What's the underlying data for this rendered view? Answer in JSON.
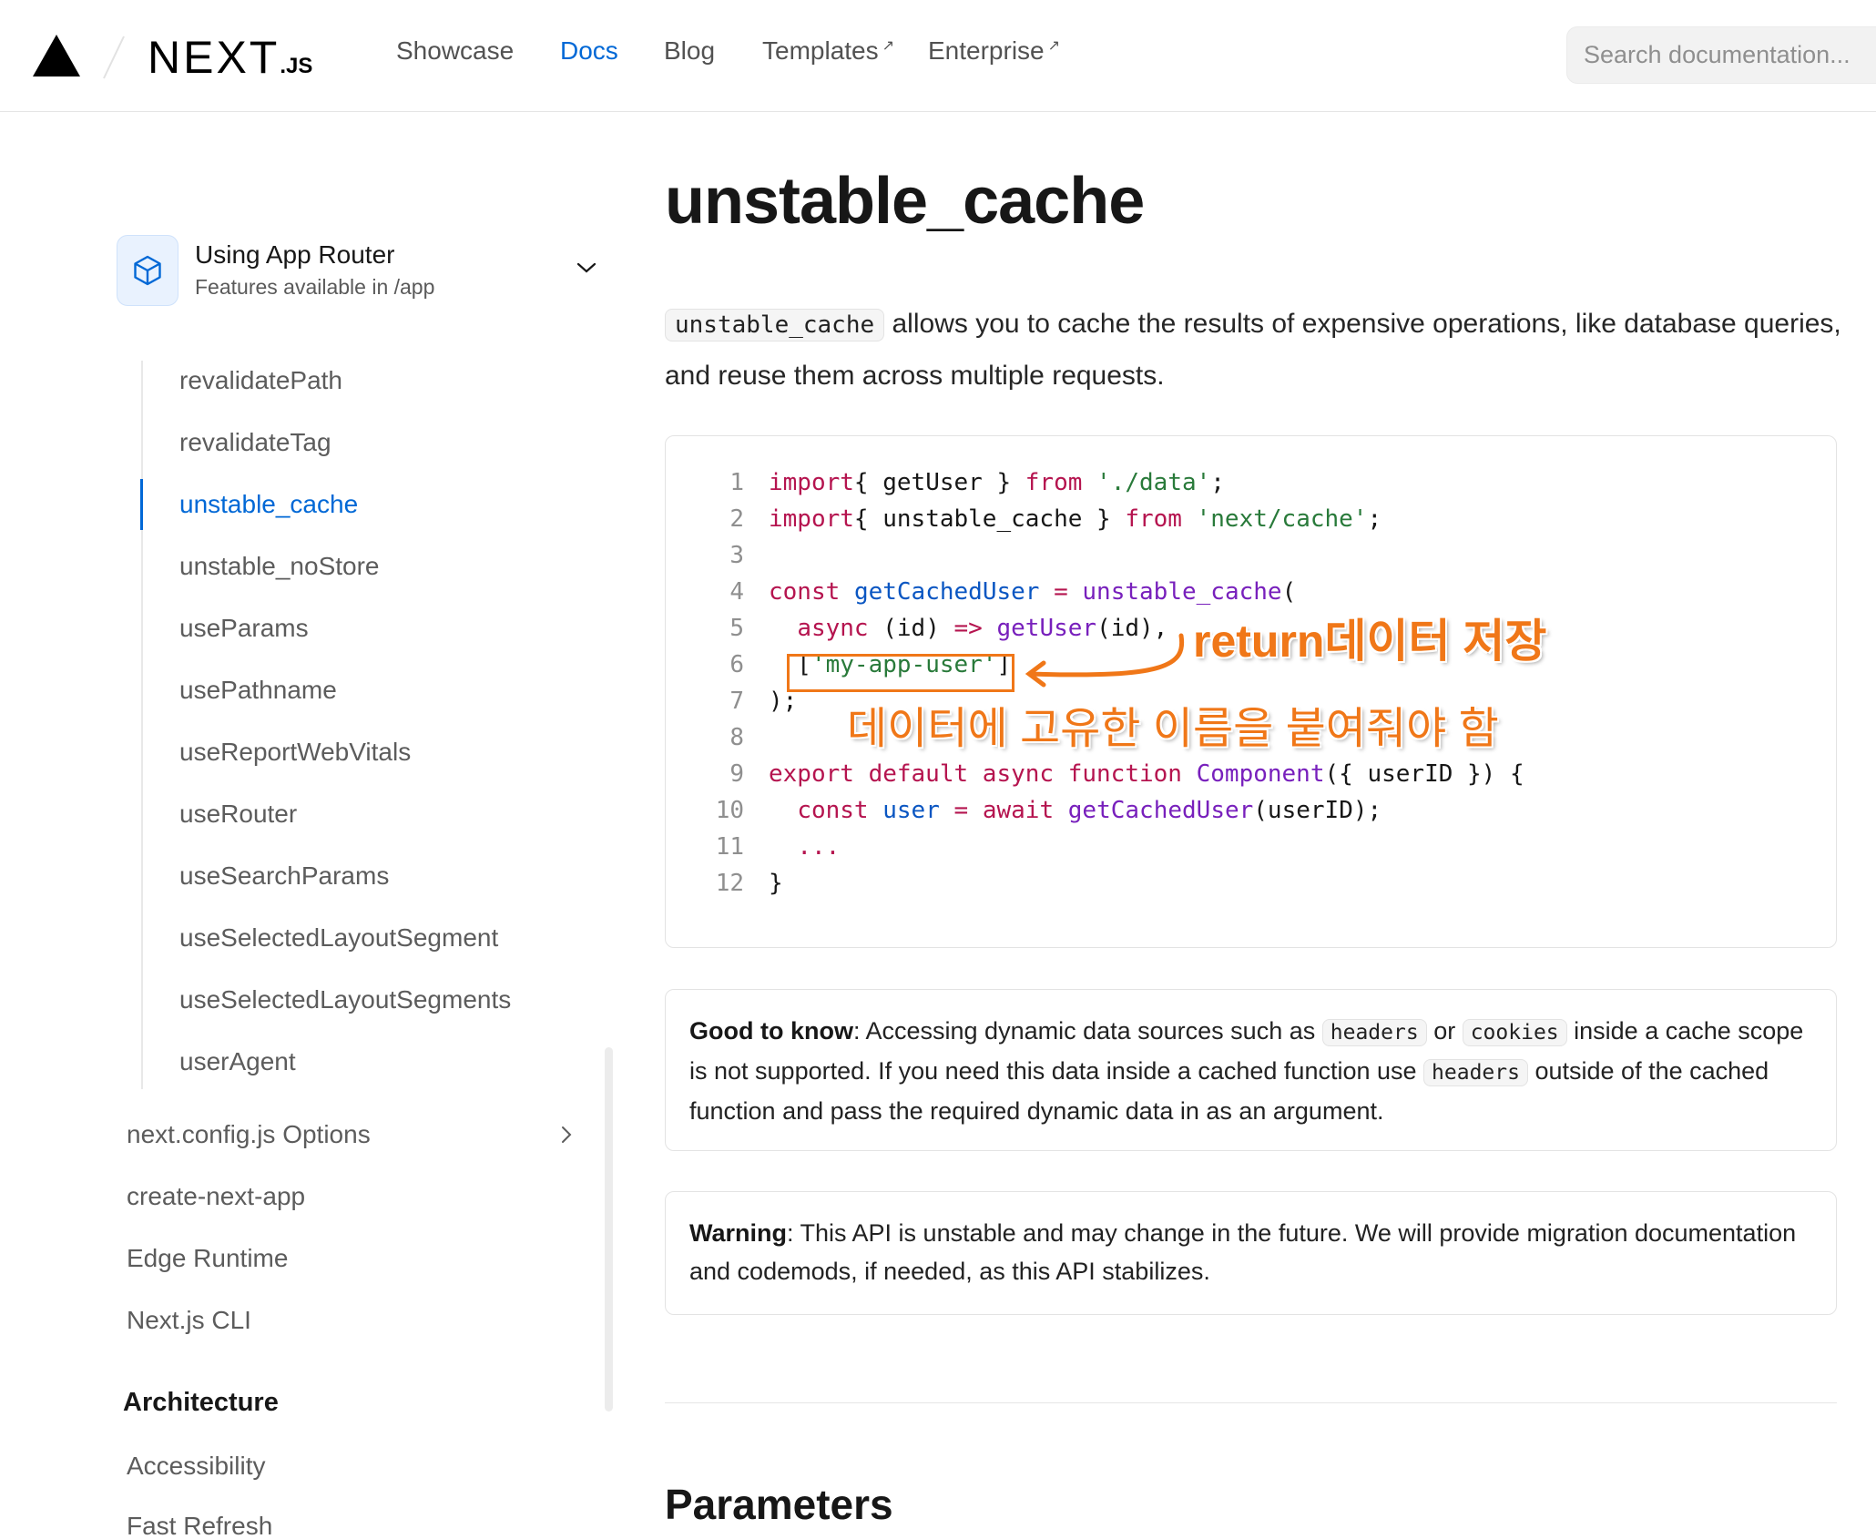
{
  "header": {
    "brand": "NEXT",
    "brand_suffix": ".JS",
    "nav": [
      {
        "label": "Showcase",
        "external": false,
        "active": false
      },
      {
        "label": "Docs",
        "external": false,
        "active": true
      },
      {
        "label": "Blog",
        "external": false,
        "active": false
      },
      {
        "label": "Templates",
        "external": true,
        "active": false
      },
      {
        "label": "Enterprise",
        "external": true,
        "active": false
      }
    ],
    "external_glyph": "↗",
    "search_placeholder": "Search documentation..."
  },
  "sidebar": {
    "router_title": "Using App Router",
    "router_subtitle": "Features available in /app",
    "sub_items": [
      {
        "label": "revalidatePath",
        "active": false
      },
      {
        "label": "revalidateTag",
        "active": false
      },
      {
        "label": "unstable_cache",
        "active": true
      },
      {
        "label": "unstable_noStore",
        "active": false
      },
      {
        "label": "useParams",
        "active": false
      },
      {
        "label": "usePathname",
        "active": false
      },
      {
        "label": "useReportWebVitals",
        "active": false
      },
      {
        "label": "useRouter",
        "active": false
      },
      {
        "label": "useSearchParams",
        "active": false
      },
      {
        "label": "useSelectedLayoutSegment",
        "active": false
      },
      {
        "label": "useSelectedLayoutSegments",
        "active": false
      },
      {
        "label": "userAgent",
        "active": false
      }
    ],
    "top_items": [
      {
        "label": "next.config.js Options",
        "has_children": true
      },
      {
        "label": "create-next-app",
        "has_children": false
      },
      {
        "label": "Edge Runtime",
        "has_children": false
      },
      {
        "label": "Next.js CLI",
        "has_children": false
      }
    ],
    "section_heading": "Architecture",
    "section_items": [
      "Accessibility",
      "Fast Refresh"
    ]
  },
  "content": {
    "title": "unstable_cache",
    "intro_code": "unstable_cache",
    "intro_text": " allows you to cache the results of expensive operations, like database queries, and reuse them across multiple requests.",
    "code_lines": [
      {
        "n": "1",
        "tokens": [
          [
            "kw",
            "import"
          ],
          [
            "",
            "{ getUser } "
          ],
          [
            "kw",
            "from"
          ],
          [
            "",
            " "
          ],
          [
            "str",
            "'./data'"
          ],
          [
            "",
            ";"
          ]
        ]
      },
      {
        "n": "2",
        "tokens": [
          [
            "kw",
            "import"
          ],
          [
            "",
            "{ unstable_cache } "
          ],
          [
            "kw",
            "from"
          ],
          [
            "",
            " "
          ],
          [
            "str",
            "'next/cache'"
          ],
          [
            "",
            ";"
          ]
        ]
      },
      {
        "n": "3",
        "tokens": []
      },
      {
        "n": "4",
        "tokens": [
          [
            "kw",
            "const"
          ],
          [
            "",
            " "
          ],
          [
            "var",
            "getCachedUser"
          ],
          [
            "",
            " "
          ],
          [
            "kw",
            "="
          ],
          [
            "",
            " "
          ],
          [
            "fn",
            "unstable_cache"
          ],
          [
            "",
            "("
          ]
        ]
      },
      {
        "n": "5",
        "tokens": [
          [
            "",
            "  "
          ],
          [
            "kw",
            "async"
          ],
          [
            "",
            " (id) "
          ],
          [
            "kw",
            "=>"
          ],
          [
            "",
            " "
          ],
          [
            "fn",
            "getUser"
          ],
          [
            "",
            "(id),"
          ]
        ]
      },
      {
        "n": "6",
        "tokens": [
          [
            "",
            "  ["
          ],
          [
            "str",
            "'my-app-user'"
          ],
          [
            "",
            "]"
          ]
        ]
      },
      {
        "n": "7",
        "tokens": [
          [
            "",
            ");"
          ]
        ]
      },
      {
        "n": "8",
        "tokens": []
      },
      {
        "n": "9",
        "tokens": [
          [
            "kw",
            "export default async function"
          ],
          [
            "",
            " "
          ],
          [
            "fn",
            "Component"
          ],
          [
            "",
            "({ userID }) {"
          ]
        ]
      },
      {
        "n": "10",
        "tokens": [
          [
            "",
            "  "
          ],
          [
            "kw",
            "const"
          ],
          [
            "",
            " "
          ],
          [
            "var",
            "user"
          ],
          [
            "",
            " "
          ],
          [
            "kw",
            "="
          ],
          [
            "",
            " "
          ],
          [
            "kw",
            "await"
          ],
          [
            "",
            " "
          ],
          [
            "fn",
            "getCachedUser"
          ],
          [
            "",
            "(userID);"
          ]
        ]
      },
      {
        "n": "11",
        "tokens": [
          [
            "",
            "  "
          ],
          [
            "kw",
            "..."
          ]
        ]
      },
      {
        "n": "12",
        "tokens": [
          [
            "",
            "}"
          ]
        ]
      }
    ],
    "annotation_return": "return데이터 저장",
    "annotation_name": "데이터에 고유한 이름을 붙여줘야 함",
    "good_to_know": {
      "label": "Good to know",
      "t1": ": Accessing dynamic data sources such as ",
      "c1": "headers",
      "t2": " or ",
      "c2": "cookies",
      "t3": " inside a cache scope is not supported. If you need this data inside a cached function use ",
      "c3": "headers",
      "t4": " outside of the cached function and pass the required dynamic data in as an argument."
    },
    "warning": {
      "label": "Warning",
      "text": ": This API is unstable and may change in the future. We will provide migration documentation and codemods, if needed, as this API stabilizes."
    },
    "section_title": "Parameters"
  },
  "colors": {
    "accent": "#0068d6",
    "annotation": "#f07718",
    "keyword": "#b5144f",
    "string": "#297a3a",
    "function": "#7820bc",
    "variable": "#0a56c2"
  }
}
